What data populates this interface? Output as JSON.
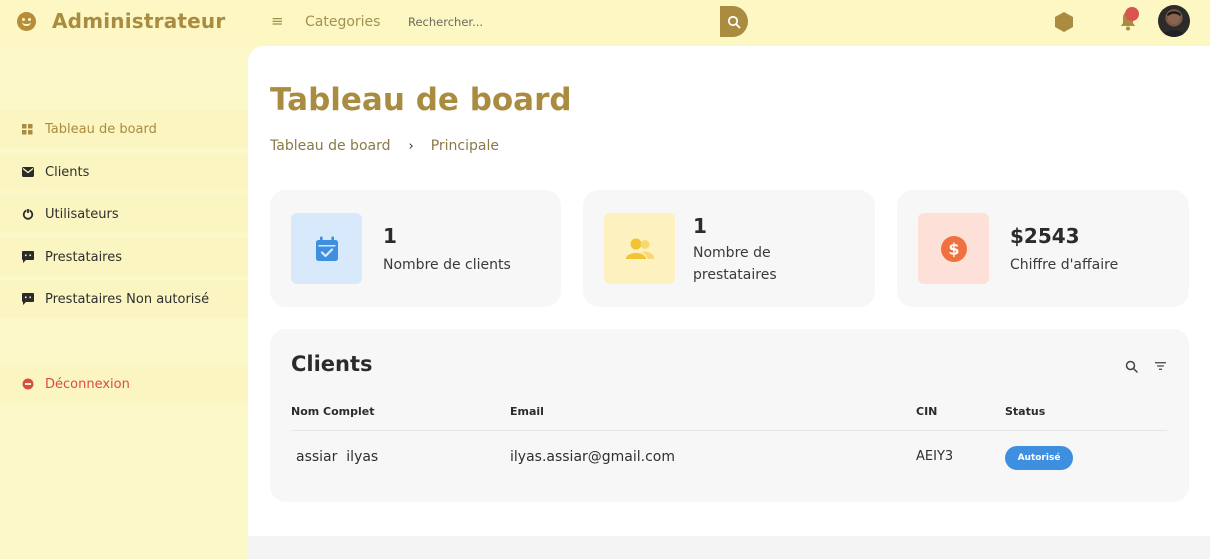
{
  "header": {
    "brand_title": "Administrateur",
    "brand_icon": "smiley-icon",
    "menu_icon": "≡",
    "nav_categories": "Categories",
    "search_placeholder": "Rechercher...",
    "search_icon": "search-icon",
    "notifications_icon": "bell-icon",
    "accent_color": "#a98c3f"
  },
  "sidebar": {
    "items": [
      {
        "label": "Tableau de board",
        "icon": "dashboard-icon",
        "active": true
      },
      {
        "label": "Clients",
        "icon": "envelope-icon"
      },
      {
        "label": "Utilisateurs",
        "icon": "power-icon"
      },
      {
        "label": "Prestataires",
        "icon": "chat-icon"
      },
      {
        "label": "Prestataires Non autorisé",
        "icon": "chat-icon"
      },
      {
        "label": "Déconnexion",
        "icon": "logout-icon",
        "danger": true
      }
    ]
  },
  "main": {
    "page_title": "Tableau de board",
    "breadcrumb": [
      "Tableau de board",
      "›",
      "Principale"
    ],
    "cards": [
      {
        "value": "1",
        "label": "Nombre de clients",
        "icon": "calendar-check-icon",
        "bg": "#d8e9fb",
        "icon_color": "#3f8fe0"
      },
      {
        "value": "1",
        "label_line1": "Nombre de",
        "label_line2": "prestataires",
        "icon": "users-icon",
        "bg": "#fdf1c0",
        "icon_color": "#f3c335"
      },
      {
        "value": "$2543",
        "label": "Chiffre d'affaire",
        "icon": "dollar-icon",
        "bg": "#fde0d8",
        "icon_color": "#f0703f"
      }
    ],
    "clients": {
      "title": "Clients",
      "columns": [
        "Nom Complet",
        "Email",
        "CIN",
        "Status"
      ],
      "rows": [
        {
          "name": "assiar  ilyas",
          "email": "ilyas.assiar@gmail.com",
          "cin": "AEIY3",
          "status": "Autorisé"
        }
      ]
    }
  }
}
